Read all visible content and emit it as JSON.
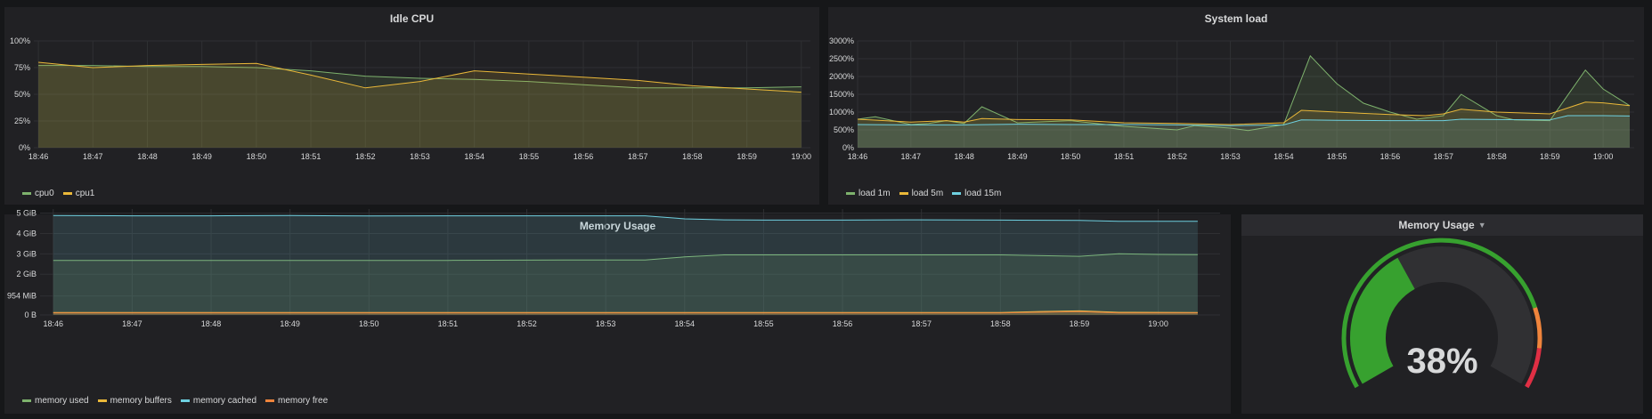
{
  "panels": {
    "idle_cpu": {
      "title": "Idle CPU",
      "chart_data": {
        "type": "area",
        "title": "Idle CPU",
        "yticks": [
          "0%",
          "25%",
          "50%",
          "75%",
          "100%"
        ],
        "ylim": [
          0,
          100
        ],
        "xticks": [
          "18:46",
          "18:47",
          "18:48",
          "18:49",
          "18:50",
          "18:51",
          "18:52",
          "18:53",
          "18:54",
          "18:55",
          "18:56",
          "18:57",
          "18:58",
          "18:59",
          "19:00"
        ],
        "grid": true,
        "legend_placement": "bottom-left",
        "series": [
          {
            "name": "cpu0",
            "color": "#7eb26d",
            "points": [
              [
                "18:46",
                77
              ],
              [
                "18:47",
                77
              ],
              [
                "18:48",
                76
              ],
              [
                "18:49",
                76
              ],
              [
                "18:50",
                75
              ],
              [
                "18:51",
                72
              ],
              [
                "18:52",
                67
              ],
              [
                "18:53",
                65
              ],
              [
                "18:54",
                64
              ],
              [
                "18:55",
                62
              ],
              [
                "18:56",
                59
              ],
              [
                "18:57",
                56
              ],
              [
                "18:58",
                56
              ],
              [
                "18:59",
                56
              ],
              [
                "19:00",
                57
              ]
            ]
          },
          {
            "name": "cpu1",
            "color": "#eab839",
            "points": [
              [
                "18:46",
                80
              ],
              [
                "18:47",
                75
              ],
              [
                "18:48",
                77
              ],
              [
                "18:49",
                78
              ],
              [
                "18:50",
                79
              ],
              [
                "18:51",
                68
              ],
              [
                "18:52",
                56
              ],
              [
                "18:53",
                62
              ],
              [
                "18:54",
                72
              ],
              [
                "18:55",
                69
              ],
              [
                "18:56",
                66
              ],
              [
                "18:57",
                63
              ],
              [
                "18:58",
                58
              ],
              [
                "18:59",
                55
              ],
              [
                "19:00",
                52
              ]
            ]
          }
        ]
      }
    },
    "system_load": {
      "title": "System load",
      "chart_data": {
        "type": "area",
        "title": "System load",
        "yticks": [
          "0%",
          "500%",
          "1000%",
          "1500%",
          "2000%",
          "2500%",
          "3000%"
        ],
        "ylim": [
          0,
          3000
        ],
        "xticks": [
          "18:46",
          "18:47",
          "18:48",
          "18:49",
          "18:50",
          "18:51",
          "18:52",
          "18:53",
          "18:54",
          "18:55",
          "18:56",
          "18:57",
          "18:58",
          "18:59",
          "19:00"
        ],
        "grid": true,
        "legend_placement": "bottom-left",
        "series": [
          {
            "name": "load 1m",
            "color": "#7eb26d",
            "points": [
              [
                "18:46",
                800
              ],
              [
                "18:46:20",
                870
              ],
              [
                "18:47",
                650
              ],
              [
                "18:47:20",
                680
              ],
              [
                "18:47:40",
                760
              ],
              [
                "18:48",
                680
              ],
              [
                "18:48:20",
                1150
              ],
              [
                "18:49",
                700
              ],
              [
                "18:50",
                760
              ],
              [
                "18:50:40",
                650
              ],
              [
                "18:51",
                600
              ],
              [
                "18:52",
                500
              ],
              [
                "18:52:20",
                620
              ],
              [
                "18:53",
                550
              ],
              [
                "18:53:20",
                480
              ],
              [
                "18:54",
                650
              ],
              [
                "18:54:30",
                2580
              ],
              [
                "18:55",
                1800
              ],
              [
                "18:55:30",
                1250
              ],
              [
                "18:56",
                1000
              ],
              [
                "18:56:30",
                800
              ],
              [
                "18:57",
                900
              ],
              [
                "18:57:20",
                1500
              ],
              [
                "18:58",
                900
              ],
              [
                "18:58:20",
                780
              ],
              [
                "18:59",
                760
              ],
              [
                "18:59:40",
                2180
              ],
              [
                "19:00",
                1650
              ],
              [
                "19:00:30",
                1180
              ]
            ]
          },
          {
            "name": "load 5m",
            "color": "#eab839",
            "points": [
              [
                "18:46",
                800
              ],
              [
                "18:47",
                720
              ],
              [
                "18:47:40",
                760
              ],
              [
                "18:48",
                720
              ],
              [
                "18:48:20",
                820
              ],
              [
                "18:49",
                790
              ],
              [
                "18:50",
                780
              ],
              [
                "18:51",
                700
              ],
              [
                "18:52",
                680
              ],
              [
                "18:53",
                650
              ],
              [
                "18:54",
                700
              ],
              [
                "18:54:20",
                1050
              ],
              [
                "18:55",
                1000
              ],
              [
                "18:56",
                930
              ],
              [
                "18:56:40",
                900
              ],
              [
                "18:57",
                950
              ],
              [
                "18:57:20",
                1080
              ],
              [
                "18:58",
                1000
              ],
              [
                "18:59",
                950
              ],
              [
                "18:59:40",
                1280
              ],
              [
                "19:00",
                1260
              ],
              [
                "19:00:30",
                1180
              ]
            ]
          },
          {
            "name": "load 15m",
            "color": "#6ed0e0",
            "points": [
              [
                "18:46",
                650
              ],
              [
                "18:47",
                640
              ],
              [
                "18:48",
                640
              ],
              [
                "18:49",
                660
              ],
              [
                "18:50",
                650
              ],
              [
                "18:51",
                650
              ],
              [
                "18:52",
                640
              ],
              [
                "18:53",
                620
              ],
              [
                "18:54",
                640
              ],
              [
                "18:54:20",
                780
              ],
              [
                "18:55",
                770
              ],
              [
                "18:56",
                760
              ],
              [
                "18:57",
                760
              ],
              [
                "18:57:20",
                800
              ],
              [
                "18:58",
                790
              ],
              [
                "18:59",
                780
              ],
              [
                "18:59:20",
                900
              ],
              [
                "19:00",
                900
              ],
              [
                "19:00:30",
                890
              ]
            ]
          }
        ]
      }
    },
    "memory_usage": {
      "title": "Memory Usage",
      "chart_data": {
        "type": "area",
        "title": "Memory Usage",
        "yticks": [
          "0 B",
          "954 MiB",
          "2 GiB",
          "3 GiB",
          "4 GiB",
          "5 GiB"
        ],
        "ylim_gib": [
          0,
          5.2
        ],
        "xticks": [
          "18:46",
          "18:47",
          "18:48",
          "18:49",
          "18:50",
          "18:51",
          "18:52",
          "18:53",
          "18:54",
          "18:55",
          "18:56",
          "18:57",
          "18:58",
          "18:59",
          "19:00"
        ],
        "grid": true,
        "legend_placement": "bottom-left",
        "series": [
          {
            "name": "memory used",
            "color": "#7eb26d",
            "points_gib": [
              [
                "18:46",
                2.68
              ],
              [
                "18:47",
                2.68
              ],
              [
                "18:48",
                2.68
              ],
              [
                "18:49",
                2.68
              ],
              [
                "18:50",
                2.68
              ],
              [
                "18:51",
                2.68
              ],
              [
                "18:52",
                2.69
              ],
              [
                "18:53",
                2.7
              ],
              [
                "18:53:30",
                2.7
              ],
              [
                "18:54",
                2.85
              ],
              [
                "18:54:30",
                2.95
              ],
              [
                "18:55",
                2.95
              ],
              [
                "18:56",
                2.95
              ],
              [
                "18:57",
                2.95
              ],
              [
                "18:58",
                2.95
              ],
              [
                "18:59",
                2.88
              ],
              [
                "18:59:30",
                3.0
              ],
              [
                "19:00",
                2.97
              ],
              [
                "19:00:30",
                2.96
              ]
            ]
          },
          {
            "name": "memory buffers",
            "color": "#eab839",
            "points_gib": [
              [
                "18:46",
                0.12
              ],
              [
                "18:50",
                0.12
              ],
              [
                "18:55",
                0.12
              ],
              [
                "18:58",
                0.12
              ],
              [
                "18:58:30",
                0.17
              ],
              [
                "18:59",
                0.2
              ],
              [
                "18:59:30",
                0.13
              ],
              [
                "19:00:30",
                0.12
              ]
            ]
          },
          {
            "name": "memory cached",
            "color": "#6ed0e0",
            "points_gib": [
              [
                "18:46",
                4.88
              ],
              [
                "18:47",
                4.87
              ],
              [
                "18:48",
                4.87
              ],
              [
                "18:49",
                4.88
              ],
              [
                "18:50",
                4.86
              ],
              [
                "18:51",
                4.87
              ],
              [
                "18:52",
                4.87
              ],
              [
                "18:53",
                4.87
              ],
              [
                "18:53:30",
                4.87
              ],
              [
                "18:54",
                4.72
              ],
              [
                "18:54:30",
                4.67
              ],
              [
                "18:55",
                4.66
              ],
              [
                "18:56",
                4.66
              ],
              [
                "18:57",
                4.67
              ],
              [
                "18:58",
                4.66
              ],
              [
                "18:59",
                4.64
              ],
              [
                "18:59:30",
                4.6
              ],
              [
                "19:00",
                4.6
              ],
              [
                "19:00:30",
                4.6
              ]
            ]
          },
          {
            "name": "memory free",
            "color": "#ef843c",
            "points_gib": [
              [
                "18:46",
                0.1
              ],
              [
                "18:55",
                0.1
              ],
              [
                "18:58",
                0.1
              ],
              [
                "18:59",
                0.16
              ],
              [
                "18:59:30",
                0.1
              ],
              [
                "19:00:30",
                0.1
              ]
            ]
          }
        ]
      }
    },
    "memory_gauge": {
      "title": "Memory Usage",
      "value_text": "38%",
      "value_percent": 38,
      "thresholds": [
        {
          "from": 0,
          "to": 80,
          "color": "#37a12f"
        },
        {
          "from": 80,
          "to": 90,
          "color": "#ef843c"
        },
        {
          "from": 90,
          "to": 100,
          "color": "#e02f44"
        }
      ],
      "caret_icon": "caret-down-icon"
    }
  }
}
